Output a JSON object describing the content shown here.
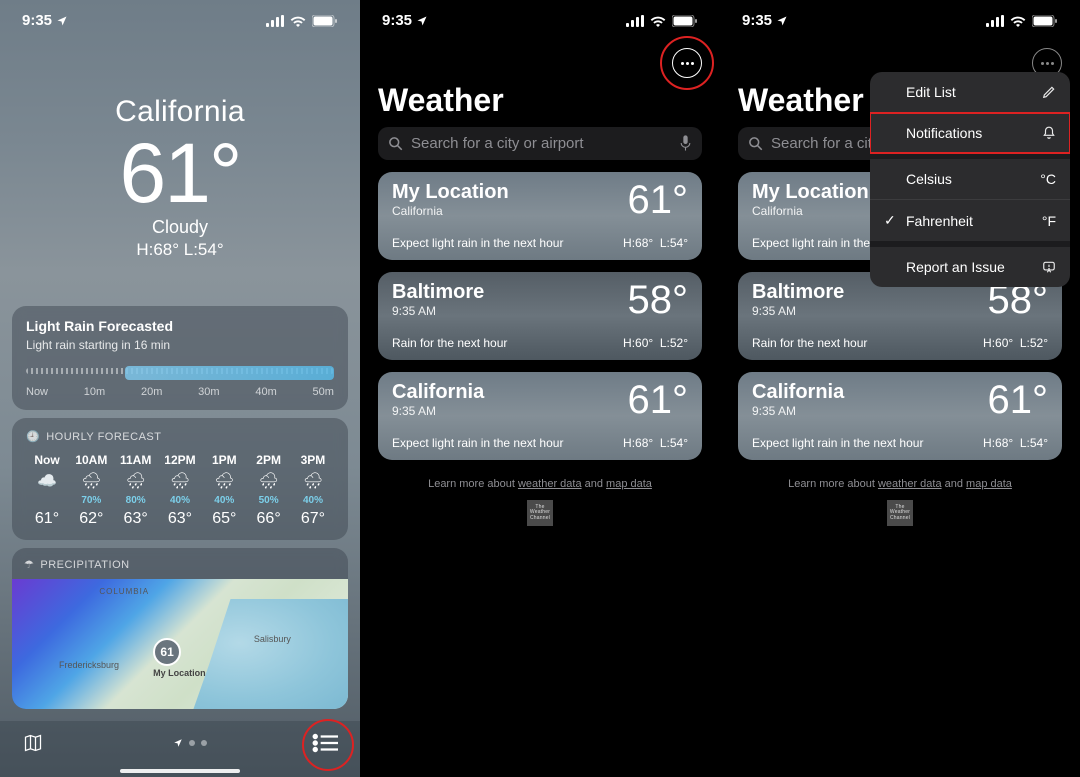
{
  "status": {
    "time": "9:35",
    "battery": 95
  },
  "p1": {
    "location": "California",
    "temp": "61°",
    "condition": "Cloudy",
    "hi_lo": "H:68°  L:54°",
    "forecast_card": {
      "title": "Light Rain Forecasted",
      "subtitle": "Light rain starting in 16 min",
      "axis": [
        "Now",
        "10m",
        "20m",
        "30m",
        "40m",
        "50m"
      ]
    },
    "hourly_label": "HOURLY FORECAST",
    "hourly": [
      {
        "time": "Now",
        "icon": "☁️",
        "pct": "",
        "temp": "61°"
      },
      {
        "time": "10AM",
        "icon": "🌧",
        "pct": "70%",
        "temp": "62°"
      },
      {
        "time": "11AM",
        "icon": "🌧",
        "pct": "80%",
        "temp": "63°"
      },
      {
        "time": "12PM",
        "icon": "🌧",
        "pct": "40%",
        "temp": "63°"
      },
      {
        "time": "1PM",
        "icon": "🌧",
        "pct": "40%",
        "temp": "65°"
      },
      {
        "time": "2PM",
        "icon": "🌧",
        "pct": "50%",
        "temp": "66°"
      },
      {
        "time": "3PM",
        "icon": "🌧",
        "pct": "40%",
        "temp": "67°"
      }
    ],
    "precip_label": "PRECIPITATION",
    "map": {
      "pin_temp": "61",
      "pin_label": "My Location",
      "l1": "COLUMBIA",
      "l2": "Fredericksburg",
      "l3": "Salisbury"
    }
  },
  "list": {
    "title": "Weather",
    "search_placeholder": "Search for a city or airport",
    "cards": [
      {
        "name": "My Location",
        "sub": "California",
        "temp": "61°",
        "desc": "Expect light rain in the next hour",
        "hi": "H:68°",
        "lo": "L:54°"
      },
      {
        "name": "Baltimore",
        "sub": "9:35 AM",
        "temp": "58°",
        "desc": "Rain for the next hour",
        "hi": "H:60°",
        "lo": "L:52°"
      },
      {
        "name": "California",
        "sub": "9:35 AM",
        "temp": "61°",
        "desc": "Expect light rain in the next hour",
        "hi": "H:68°",
        "lo": "L:54°"
      }
    ],
    "footer_pre": "Learn more about ",
    "footer_l1": "weather data",
    "footer_mid": " and ",
    "footer_l2": "map data",
    "twc": "The Weather Channel"
  },
  "p3": {
    "search_truncated": "Search for a city or",
    "menu": {
      "edit": "Edit List",
      "notif": "Notifications",
      "celsius": "Celsius",
      "celsius_sym": "°C",
      "fahr": "Fahrenheit",
      "fahr_sym": "°F",
      "report": "Report an Issue"
    }
  }
}
